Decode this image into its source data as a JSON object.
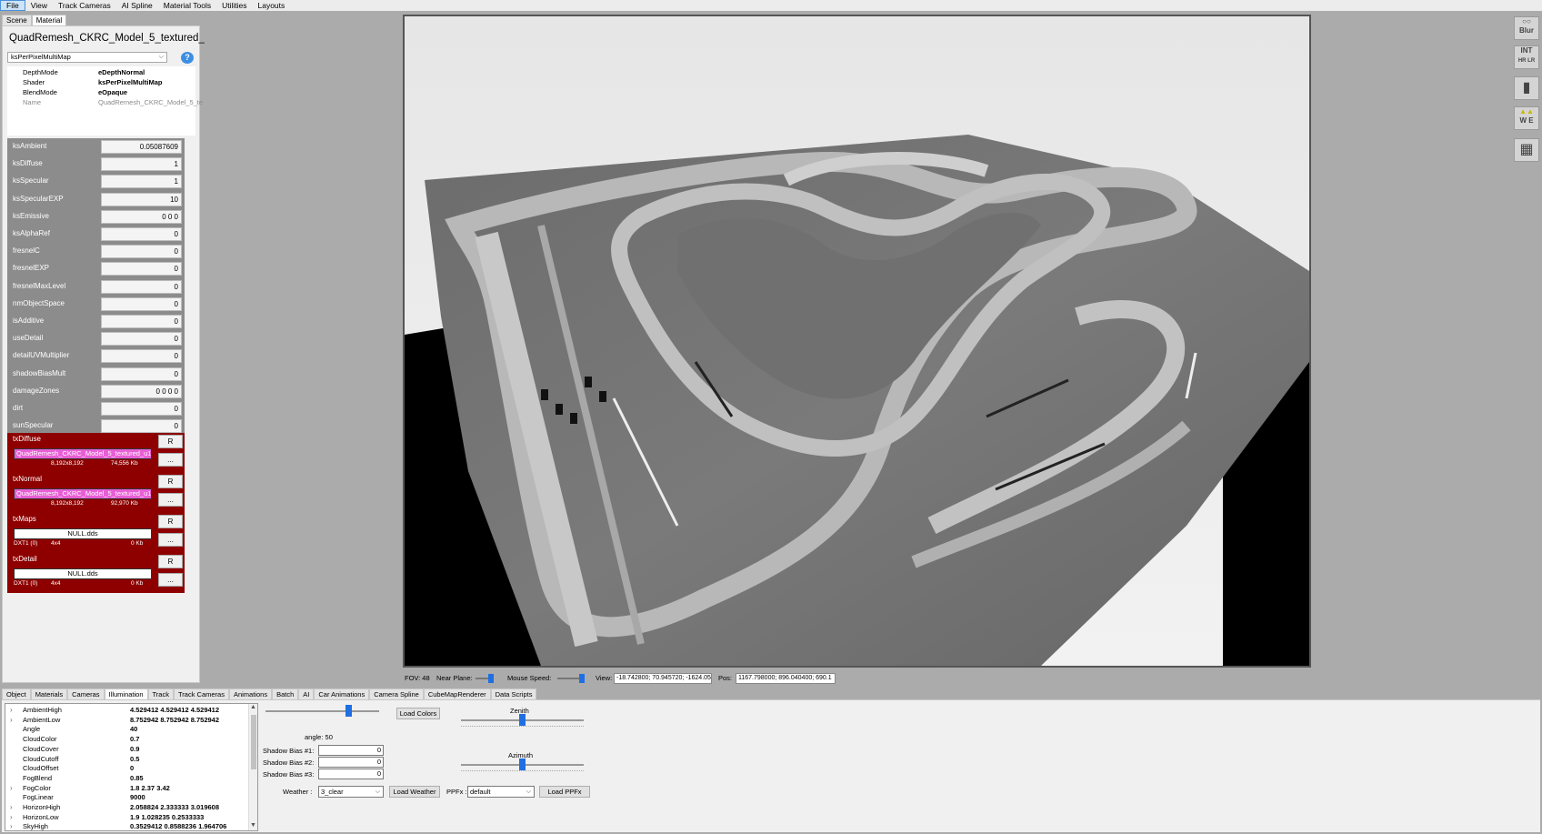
{
  "menu": [
    "File",
    "View",
    "Track Cameras",
    "AI Spline",
    "Material Tools",
    "Utilities",
    "Layouts"
  ],
  "left_tabs": [
    "Scene",
    "Material"
  ],
  "material": {
    "title": "QuadRemesh_CKRC_Model_5_textured_",
    "shader_select": "ksPerPixelMultiMap",
    "help_icon": "?",
    "props": [
      {
        "key": "DepthMode",
        "value": "eDepthNormal"
      },
      {
        "key": "Shader",
        "value": "ksPerPixelMultiMap"
      },
      {
        "key": "BlendMode",
        "value": "eOpaque"
      },
      {
        "key": "Name",
        "value": "QuadRemesh_CKRC_Model_5_te"
      }
    ],
    "params": [
      {
        "name": "ksAmbient",
        "value": "0.05087609"
      },
      {
        "name": "ksDiffuse",
        "value": "1"
      },
      {
        "name": "ksSpecular",
        "value": "1"
      },
      {
        "name": "ksSpecularEXP",
        "value": "10"
      },
      {
        "name": "ksEmissive",
        "value": "0 0 0"
      },
      {
        "name": "ksAlphaRef",
        "value": "0"
      },
      {
        "name": "fresnelC",
        "value": "0"
      },
      {
        "name": "fresnelEXP",
        "value": "0"
      },
      {
        "name": "fresnelMaxLevel",
        "value": "0"
      },
      {
        "name": "nmObjectSpace",
        "value": "0"
      },
      {
        "name": "isAdditive",
        "value": "0"
      },
      {
        "name": "useDetail",
        "value": "0"
      },
      {
        "name": "detailUVMultiplier",
        "value": "0"
      },
      {
        "name": "shadowBiasMult",
        "value": "0"
      },
      {
        "name": "damageZones",
        "value": "0 0 0 0"
      },
      {
        "name": "dirt",
        "value": "0"
      },
      {
        "name": "sunSpecular",
        "value": "0"
      },
      {
        "name": "sunSpecularEXP",
        "value": "0"
      }
    ],
    "textures": [
      {
        "name": "txDiffuse",
        "file": "QuadRemesh_CKRC_Model_5_textured_u1",
        "fmt": "",
        "dims": "8,192x8,192",
        "size": "74,556 Kb"
      },
      {
        "name": "txNormal",
        "file": "QuadRemesh_CKRC_Model_5_textured_u1",
        "fmt": "",
        "dims": "8,192x8,192",
        "size": "92,970 Kb"
      },
      {
        "name": "txMaps",
        "file": "NULL.dds",
        "fmt": "DXT1 (0)",
        "dims": "4x4",
        "size": "0 Kb"
      },
      {
        "name": "txDetail",
        "file": "NULL.dds",
        "fmt": "DXT1 (0)",
        "dims": "4x4",
        "size": "0 Kb"
      }
    ],
    "btn_reload": "R",
    "btn_browse": "..."
  },
  "status": {
    "fov": "FOV: 48",
    "near_plane_label": "Near Plane:",
    "mouse_speed_label": "Mouse Speed:",
    "view_label": "View:",
    "view_value": "-18.742800; 70.945720; -1624.05",
    "pos_label": "Pos:",
    "pos_value": "1167.798000; 896.040400; 690.1"
  },
  "right_toolbar": [
    {
      "icon": "blur-icon",
      "label": "Blur"
    },
    {
      "icon": "int-icon",
      "label": "INT"
    },
    {
      "icon": "car-icon",
      "label": ""
    },
    {
      "icon": "we-icon",
      "label": "W E"
    },
    {
      "icon": "grid-icon",
      "label": ""
    }
  ],
  "bottom_tabs": [
    "Object",
    "Materials",
    "Cameras",
    "Illumination",
    "Track",
    "Track Cameras",
    "Animations",
    "Batch",
    "AI",
    "Car Animations",
    "Camera Spline",
    "CubeMapRenderer",
    "Data Scripts"
  ],
  "illumination": [
    {
      "expand": true,
      "key": "AmbientHigh",
      "value": "4.529412 4.529412 4.529412"
    },
    {
      "expand": true,
      "key": "AmbientLow",
      "value": "8.752942 8.752942 8.752942"
    },
    {
      "expand": false,
      "key": "Angle",
      "value": "40"
    },
    {
      "expand": false,
      "key": "CloudColor",
      "value": "0.7"
    },
    {
      "expand": false,
      "key": "CloudCover",
      "value": "0.9"
    },
    {
      "expand": false,
      "key": "CloudCutoff",
      "value": "0.5"
    },
    {
      "expand": false,
      "key": "CloudOffset",
      "value": "0"
    },
    {
      "expand": false,
      "key": "FogBlend",
      "value": "0.85"
    },
    {
      "expand": true,
      "key": "FogColor",
      "value": "1.8 2.37 3.42"
    },
    {
      "expand": false,
      "key": "FogLinear",
      "value": "9000"
    },
    {
      "expand": true,
      "key": "HorizonHigh",
      "value": "2.058824 2.333333 3.019608"
    },
    {
      "expand": true,
      "key": "HorizonLow",
      "value": "1.9 1.028235 0.2533333"
    },
    {
      "expand": true,
      "key": "SkyHigh",
      "value": "0.3529412 0.8588236 1.964706"
    }
  ],
  "controls": {
    "load_colors": "Load Colors",
    "angle_text": "angle: 50",
    "zenith": "Zenith",
    "azimuth": "Azimuth",
    "shadow_bias": [
      {
        "label": "Shadow Bias #1:",
        "value": "0"
      },
      {
        "label": "Shadow Bias #2:",
        "value": "0"
      },
      {
        "label": "Shadow Bias #3:",
        "value": "0"
      }
    ],
    "weather_label": "Weather :",
    "weather_value": "3_clear",
    "load_weather": "Load Weather",
    "ppfx_label": "PPFx :",
    "ppfx_value": "default",
    "load_ppfx": "Load PPFx"
  }
}
